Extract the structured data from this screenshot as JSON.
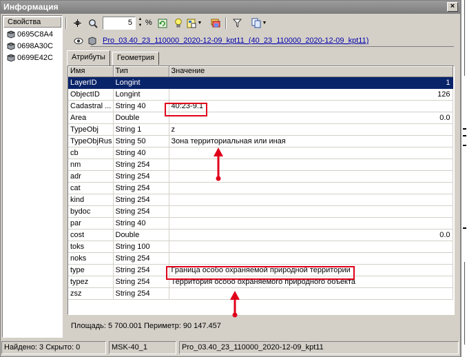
{
  "window": {
    "title": "Информация",
    "close_glyph": "×"
  },
  "left_panel": {
    "header": "Свойства",
    "items": [
      "0695C8A4",
      "0698A30C",
      "0699E42C"
    ]
  },
  "toolbar": {
    "zoom_value": "5",
    "zoom_unit": "%"
  },
  "object": {
    "link": "Pro_03.40_23_110000_2020-12-09_kpt11_(40_23_110000_2020-12-09_kpt11)"
  },
  "tabs": [
    "Атрибуты",
    "Геометрия"
  ],
  "table": {
    "columns": [
      "Имя",
      "Тип",
      "Значение"
    ],
    "rows": [
      {
        "name": "LayerID",
        "type": "Longint",
        "value": "1",
        "numeric": true,
        "selected": true
      },
      {
        "name": "ObjectID",
        "type": "Longint",
        "value": "126",
        "numeric": true
      },
      {
        "name": "Cadastral ...",
        "type": "String 40",
        "value": "40:23-9.1"
      },
      {
        "name": "Area",
        "type": "Double",
        "value": "0.0",
        "numeric": true
      },
      {
        "name": "TypeObj",
        "type": "String 1",
        "value": "z"
      },
      {
        "name": "TypeObjRus",
        "type": "String 50",
        "value": "Зона территориальная или иная"
      },
      {
        "name": "cb",
        "type": "String 40",
        "value": ""
      },
      {
        "name": "nm",
        "type": "String 254",
        "value": ""
      },
      {
        "name": "adr",
        "type": "String 254",
        "value": ""
      },
      {
        "name": "cat",
        "type": "String 254",
        "value": ""
      },
      {
        "name": "kind",
        "type": "String 254",
        "value": ""
      },
      {
        "name": "bydoc",
        "type": "String 254",
        "value": ""
      },
      {
        "name": "par",
        "type": "String 40",
        "value": ""
      },
      {
        "name": "cost",
        "type": "Double",
        "value": "0.0",
        "numeric": true
      },
      {
        "name": "toks",
        "type": "String 100",
        "value": ""
      },
      {
        "name": "noks",
        "type": "String 254",
        "value": ""
      },
      {
        "name": "type",
        "type": "String 254",
        "value": "Граница особо охраняемой природной территории"
      },
      {
        "name": "typez",
        "type": "String 254",
        "value": "Территория особо охраняемого природного объекта"
      },
      {
        "name": "zsz",
        "type": "String 254",
        "value": ""
      }
    ]
  },
  "summary": "Площадь: 5 700.001  Периметр: 90 147.457",
  "status": {
    "found": "Найдено: 3  Скрыто: 0",
    "crs": "MSK-40_1",
    "layer": "Pro_03.40_23_110000_2020-12-09_kpt11"
  },
  "colors": {
    "selection": "#0a246a",
    "highlight": "#e0001a",
    "link": "#0000aa"
  }
}
